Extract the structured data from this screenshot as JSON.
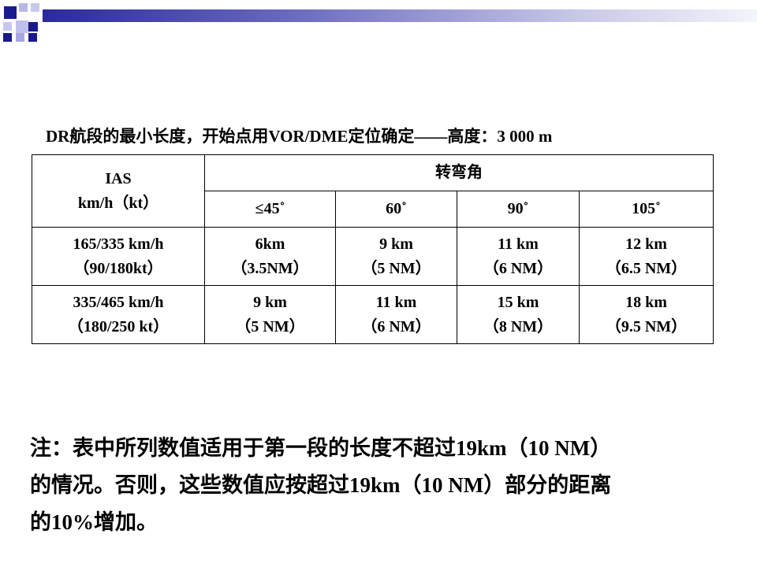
{
  "colors": {
    "accent_dark": "#1a1a8c",
    "accent_light": "#c8c8ee"
  },
  "title": "DR航段的最小长度，开始点用VOR/DME定位确定——高度：3 000 m",
  "table": {
    "ias_header": [
      "IAS",
      "km/h（kt）"
    ],
    "turn_header": "转弯角",
    "angles": [
      "≤45˚",
      "60˚",
      "90˚",
      "105˚"
    ],
    "rows": [
      {
        "ias": [
          "165/335 km/h",
          "（90/180kt）"
        ],
        "cells": [
          [
            "6km",
            "（3.5NM）"
          ],
          [
            "9 km",
            "（5 NM）"
          ],
          [
            "11 km",
            "（6 NM）"
          ],
          [
            "12 km",
            "（6.5 NM）"
          ]
        ]
      },
      {
        "ias": [
          "335/465 km/h",
          "（180/250 kt）"
        ],
        "cells": [
          [
            "9 km",
            "（5 NM）"
          ],
          [
            "11 km",
            "（6 NM）"
          ],
          [
            "15 km",
            "（8 NM）"
          ],
          [
            "18 km",
            "（9.5 NM）"
          ]
        ]
      }
    ]
  },
  "note": [
    "注：表中所列数值适用于第一段的长度不超过19km（10 NM）",
    "的情况。否则，这些数值应按超过19km（10 NM）部分的距离",
    "的10%增加。"
  ]
}
